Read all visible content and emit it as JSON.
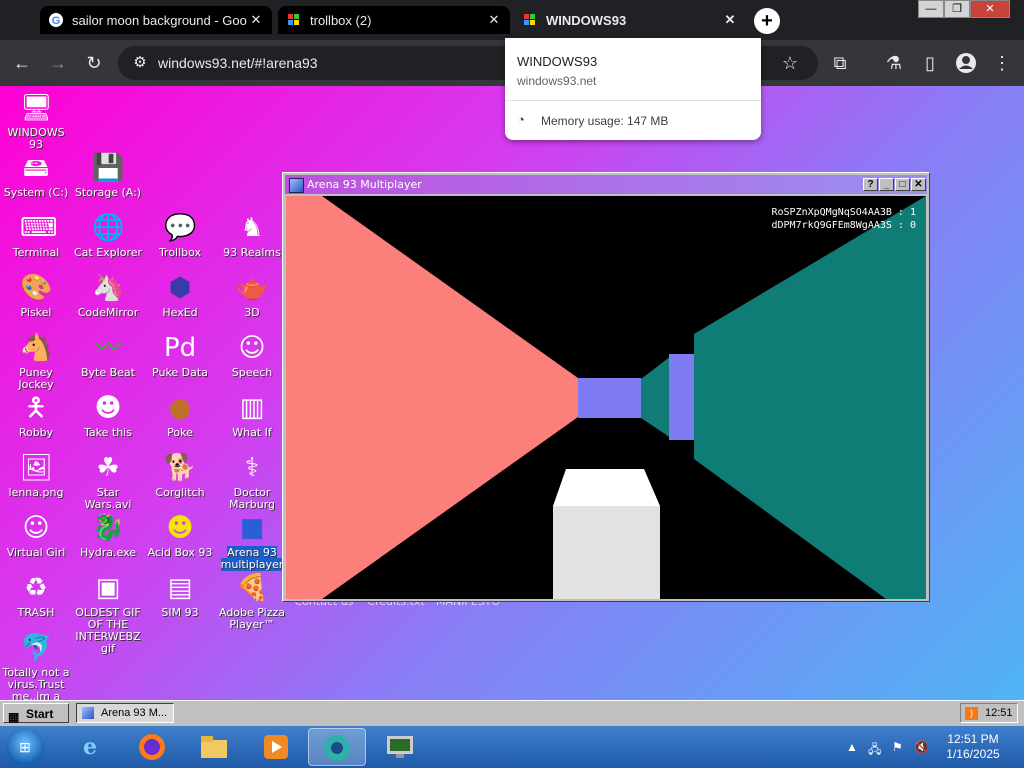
{
  "browser": {
    "tabs": [
      {
        "title": "sailor moon background - Goo",
        "favicon": "google-g-icon"
      },
      {
        "title": "trollbox (2)",
        "favicon": "windows93-icon"
      },
      {
        "title": "WINDOWS93",
        "favicon": "windows93-icon",
        "active": true
      }
    ],
    "url": "windows93.net/#!arena93",
    "popup": {
      "title": "WINDOWS93",
      "host": "windows93.net",
      "memory": "Memory usage: 147 MB"
    }
  },
  "desktop": {
    "icons": [
      {
        "label": "WINDOWS 93",
        "icon": "computer-icon"
      },
      {
        "label": "System (C:)",
        "icon": "drive-icon"
      },
      {
        "label": "Storage (A:)",
        "icon": "floppy-icon"
      },
      {
        "label": "Terminal",
        "icon": "terminal-icon"
      },
      {
        "label": "Cat Explorer",
        "icon": "cat-globe-icon"
      },
      {
        "label": "Trollbox",
        "icon": "chat-icon"
      },
      {
        "label": "93 Realms",
        "icon": "knight-icon"
      },
      {
        "label": "Piskel",
        "icon": "palette-icon"
      },
      {
        "label": "CodeMirror",
        "icon": "unicorn-icon"
      },
      {
        "label": "HexEd",
        "icon": "cube-icon"
      },
      {
        "label": "3D",
        "icon": "teapot-icon"
      },
      {
        "label": "Puney Jockey",
        "icon": "pony-icon"
      },
      {
        "label": "Byte Beat",
        "icon": "wave-icon"
      },
      {
        "label": "Puke Data",
        "icon": "pd-icon"
      },
      {
        "label": "Speech",
        "icon": "face-icon"
      },
      {
        "label": "Robby",
        "icon": "stickman-icon"
      },
      {
        "label": "Take this",
        "icon": "man-icon"
      },
      {
        "label": "Poke",
        "icon": "ball-icon"
      },
      {
        "label": "What If",
        "icon": "piano-icon"
      },
      {
        "label": "lenna.png",
        "icon": "image-icon"
      },
      {
        "label": "Star Wars.avi",
        "icon": "yoda-icon"
      },
      {
        "label": "Corglitch",
        "icon": "corgi-icon"
      },
      {
        "label": "Doctor Marburg",
        "icon": "doctor-icon"
      },
      {
        "label": "Virtual Girl",
        "icon": "girl-icon"
      },
      {
        "label": "Hydra.exe",
        "icon": "hydra-icon"
      },
      {
        "label": "Acid Box 93",
        "icon": "smiley-icon"
      },
      {
        "label": "Arena 93 multiplayer",
        "icon": "arena-cube-icon",
        "selected": true
      },
      {
        "label": "TRASH",
        "icon": "trash-icon"
      },
      {
        "label": "OLDEST GIF OF THE INTERWEBZ gif",
        "icon": "gif-icon"
      },
      {
        "label": "SIM 93",
        "icon": "sim-icon"
      },
      {
        "label": "Adobe Pizza Player™",
        "icon": "pizza-icon"
      },
      {
        "label": "Totally not a virus.Trust me..im a",
        "icon": "dolphin-icon"
      },
      {
        "label": "Contact us",
        "icon": ""
      },
      {
        "label": "Credits.txt",
        "icon": ""
      },
      {
        "label": "MANIFESTO",
        "icon": ""
      }
    ]
  },
  "arena": {
    "title": "Arena 93 Multiplayer",
    "scores": [
      "RoSPZnXpQMgNqSO4AA3B : 1",
      "dDPM7rkQ9GFEm8WgAA3S : 0"
    ],
    "colors": {
      "left_wall": "#fb7f7b",
      "right_wall": "#0f7d76",
      "block": "#7f7cf3",
      "floor": "#000000",
      "gun": "#e2e2e2"
    }
  },
  "win93_taskbar": {
    "start_label": "Start",
    "task_label": "Arena 93 M...",
    "tray_time": "12:51"
  },
  "win7_taskbar": {
    "time": "12:51 PM",
    "date": "1/16/2025"
  }
}
